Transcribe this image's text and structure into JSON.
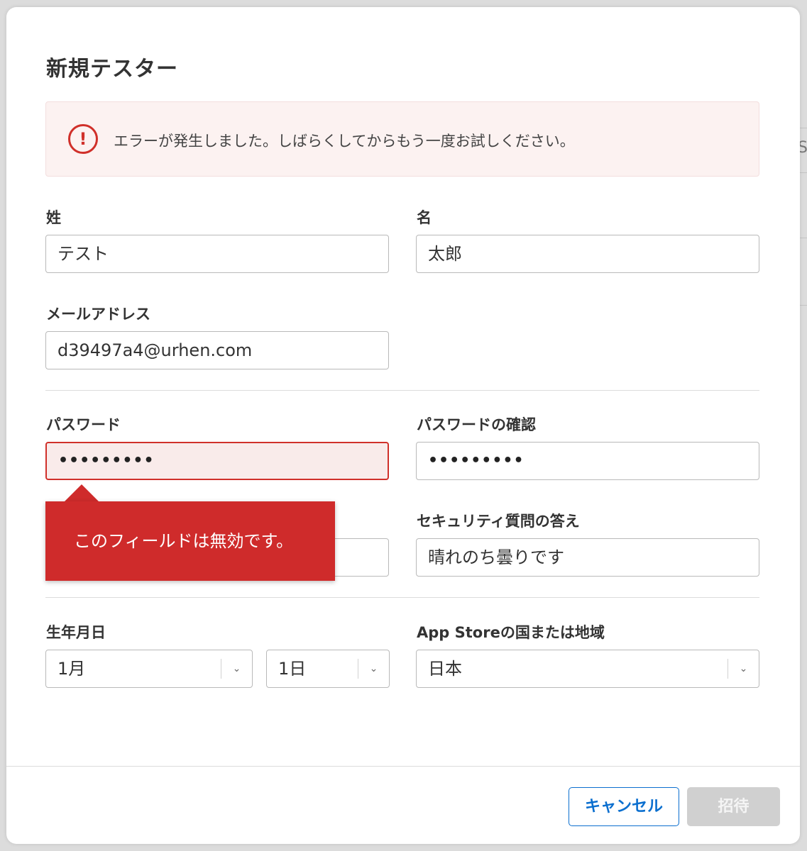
{
  "background": {
    "edge_letter": "S"
  },
  "dialog": {
    "title": "新規テスター",
    "alert": {
      "icon": "exclamation-circle-icon",
      "message": "エラーが発生しました。しばらくしてからもう一度お試しください。"
    },
    "fields": {
      "last_name": {
        "label": "姓",
        "value": "テスト"
      },
      "first_name": {
        "label": "名",
        "value": "太郎"
      },
      "email": {
        "label": "メールアドレス",
        "value": "d39497a4@urhen.com"
      },
      "password": {
        "label": "パスワード",
        "value": "•••••••••",
        "state": "error"
      },
      "password_confirm": {
        "label": "パスワードの確認",
        "value": "•••••••••"
      },
      "security_answer": {
        "label": "セキュリティ質問の答え",
        "value": "晴れのち曇りです"
      },
      "birthday": {
        "label": "生年月日",
        "month": "1月",
        "day": "1日"
      },
      "country": {
        "label": "App Storeの国または地域",
        "value": "日本"
      }
    },
    "tooltip": {
      "message": "このフィールドは無効です。"
    },
    "footer": {
      "cancel_label": "キャンセル",
      "invite_label": "招待"
    }
  },
  "colors": {
    "accent": "#0b6fcf",
    "error": "#d0302a",
    "alert_bg": "#fcf2f1",
    "disabled": "#d0d0d0"
  }
}
